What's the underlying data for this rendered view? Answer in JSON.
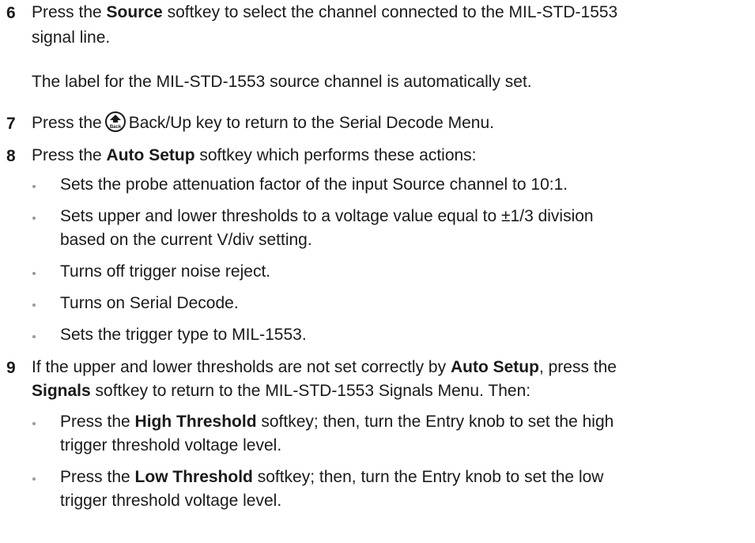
{
  "steps": {
    "s6": {
      "number": "6",
      "line1_a": "Press the ",
      "line1_bold": "Source",
      "line1_b": " softkey to select the channel connected to the MIL-STD-1553",
      "line2": "signal line.",
      "note": "The label for the MIL-STD-1553 source channel is automatically set."
    },
    "s7": {
      "number": "7",
      "text_a": "Press the",
      "icon_label": "Back",
      "text_b": "Back/Up key to return to the Serial Decode Menu."
    },
    "s8": {
      "number": "8",
      "text_a": "Press the ",
      "bold": "Auto Setup",
      "text_b": " softkey which performs these actions:",
      "bullets": [
        "Sets the probe attenuation factor of the input Source channel to 10:1.",
        "Sets upper and lower thresholds to a voltage value equal to ±1/3 division",
        "based on the current V/div setting.",
        "Turns off trigger noise reject.",
        "Turns on Serial Decode.",
        "Sets the trigger type to MIL-1553."
      ]
    },
    "s9": {
      "number": "9",
      "l1_a": "If the upper and lower thresholds are not set correctly by ",
      "l1_bold": "Auto Setup",
      "l1_b": ", press the",
      "l2_bold": "Signals",
      "l2_b": " softkey to return to the MIL-STD-1553 Signals Menu. Then:",
      "b1_a": "Press the ",
      "b1_bold": "High Threshold",
      "b1_b": " softkey; then, turn the Entry knob to set the high",
      "b1_l2": "trigger threshold voltage level.",
      "b2_a": "Press the ",
      "b2_bold": "Low Threshold",
      "b2_b": " softkey; then, turn the Entry knob to set the low",
      "b2_l2": "trigger threshold voltage level."
    }
  }
}
